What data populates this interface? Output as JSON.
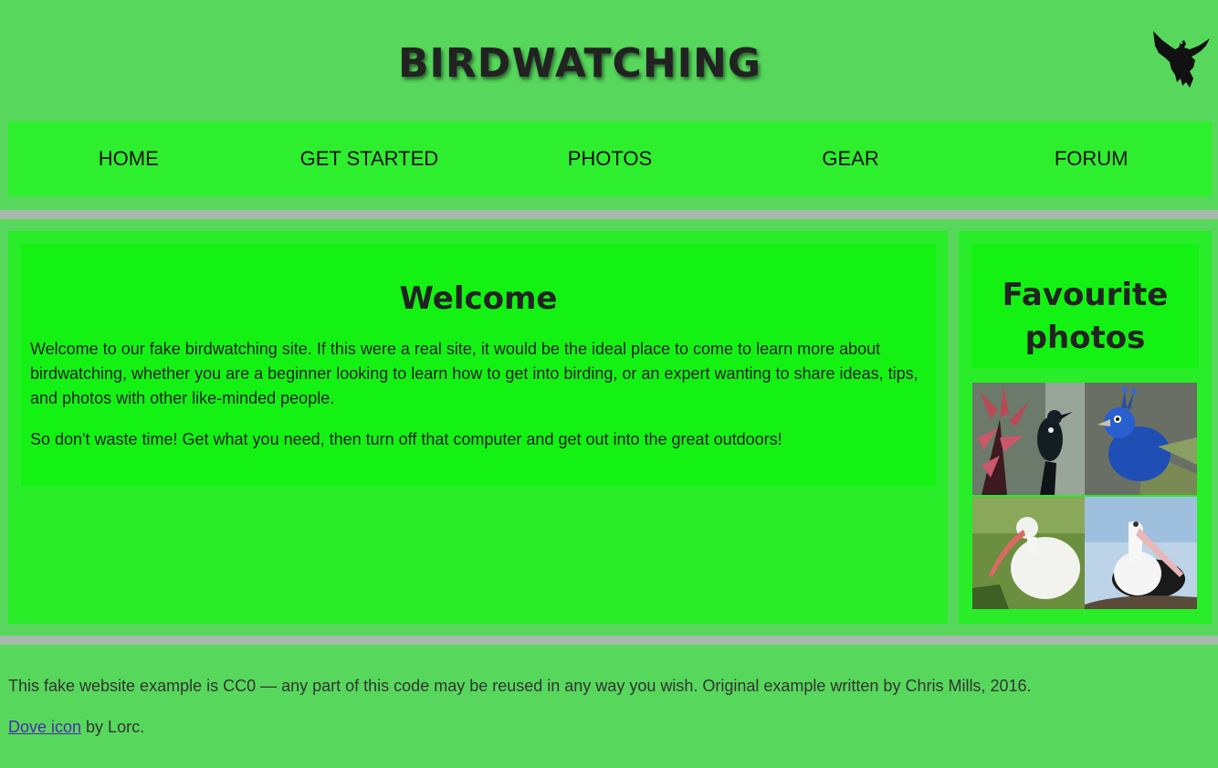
{
  "header": {
    "title": "BIRDWATCHING",
    "logo_icon": "dove-icon"
  },
  "nav": {
    "items": [
      {
        "label": "HOME"
      },
      {
        "label": "GET STARTED"
      },
      {
        "label": "PHOTOS"
      },
      {
        "label": "GEAR"
      },
      {
        "label": "FORUM"
      }
    ]
  },
  "main": {
    "heading": "Welcome",
    "paragraph1": "Welcome to our fake birdwatching site. If this were a real site, it would be the ideal place to come to learn more about birdwatching, whether you are a beginner looking to learn how to get into birding, or an expert wanting to share ideas, tips, and photos with other like-minded people.",
    "paragraph2": "So don't waste time! Get what you need, then turn off that computer and get out into the great outdoors!"
  },
  "sidebar": {
    "heading": "Favourite photos",
    "photos": [
      {
        "subject": "tui-bird-photo"
      },
      {
        "subject": "peacock-photo"
      },
      {
        "subject": "white-ibis-photo"
      },
      {
        "subject": "pelican-photo"
      }
    ]
  },
  "footer": {
    "license_text": "This fake website example is CC0 — any part of this code may be reused in any way you wish. Original example written by Chris Mills, 2016.",
    "credit_link": "Dove icon",
    "credit_suffix": " by Lorc."
  },
  "colors": {
    "page_bg": "#57d85c",
    "nav_bg": "#2eef2e",
    "panel_bg": "#28ed28",
    "box_bg": "#14f214",
    "band": "#a9b8ac",
    "link": "#4c2cab"
  }
}
